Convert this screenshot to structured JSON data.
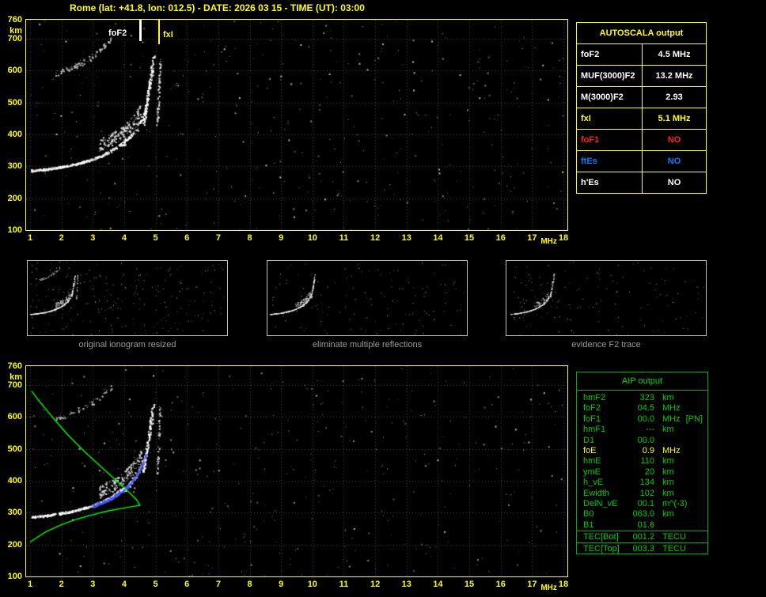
{
  "title": "Rome (lat: +41.8, lon: 012.5) - DATE: 2026 03 15 - TIME (UT): 03:00",
  "colors": {
    "background": "#000000",
    "axis_yellow": "#ffff00",
    "grid_grey": "#4a4a4a",
    "trace_white": "#ffffff",
    "profile_green": "#00ff00",
    "restored_blue": "#4455ff",
    "aip_green": "#00cc00",
    "caption_grey": "#999999",
    "alert_red": "#ff2020",
    "info_blue": "#0080ff"
  },
  "autoscala": {
    "header": "AUTOSCALA output",
    "rows": [
      {
        "label": "foF2",
        "value": "4.5 MHz",
        "color": "#ffffff"
      },
      {
        "label": "MUF(3000)F2",
        "value": "13.2 MHz",
        "color": "#ffffff"
      },
      {
        "label": "M(3000)F2",
        "value": "2.93",
        "color": "#ffffff"
      },
      {
        "label": "fxI",
        "value": "5.1 MHz",
        "color": "#ffff00"
      },
      {
        "label": "foF1",
        "value": "NO",
        "color": "#ff2020"
      },
      {
        "label": "ftEs",
        "value": "NO",
        "color": "#0080ff"
      },
      {
        "label": "h'Es",
        "value": "NO",
        "color": "#ffffff"
      }
    ]
  },
  "thumbnails": [
    {
      "caption": "original ionogram resized"
    },
    {
      "caption": "eliminate multiple reflections"
    },
    {
      "caption": "evidence F2 trace"
    }
  ],
  "aip": {
    "header": "AIP output",
    "rows": [
      {
        "label": "hmF2",
        "value": "323",
        "unit": "km",
        "note": "",
        "color": "#00cc00"
      },
      {
        "label": "foF2",
        "value": "04.5",
        "unit": "MHz",
        "note": "",
        "color": "#00cc00"
      },
      {
        "label": "foF1",
        "value": "00.0",
        "unit": "MHz",
        "note": "[PN]",
        "color": "#00cc00"
      },
      {
        "label": "hmF1",
        "value": "---",
        "unit": "km",
        "note": "",
        "color": "#00cc00"
      },
      {
        "label": "D1",
        "value": "00.0",
        "unit": "",
        "note": "",
        "color": "#00cc00"
      },
      {
        "label": "foE",
        "value": "0.9",
        "unit": "MHz",
        "note": "",
        "color": "#ffff00"
      },
      {
        "label": "hmE",
        "value": "110",
        "unit": "km",
        "note": "",
        "color": "#00cc00"
      },
      {
        "label": "ymE",
        "value": "20",
        "unit": "km",
        "note": "",
        "color": "#00cc00"
      },
      {
        "label": "h_vE",
        "value": "134",
        "unit": "km",
        "note": "",
        "color": "#00cc00"
      },
      {
        "label": "Ewidth",
        "value": "102",
        "unit": "km",
        "note": "",
        "color": "#00cc00"
      },
      {
        "label": "DelN_vE",
        "value": "00.1",
        "unit": "m^(-3)",
        "note": "",
        "color": "#00cc00"
      },
      {
        "label": "B0",
        "value": "063.0",
        "unit": "km",
        "note": "",
        "color": "#00cc00"
      },
      {
        "label": "B1",
        "value": "01.6",
        "unit": "",
        "note": "",
        "color": "#00cc00"
      }
    ],
    "tec_rows": [
      {
        "label": "TEC[Bot]",
        "value": "001.2",
        "unit": "TECU",
        "color": "#00cc00"
      },
      {
        "label": "TEC[Top]",
        "value": "003.3",
        "unit": "TECU",
        "color": "#00cc00"
      }
    ]
  },
  "chart_data": [
    {
      "type": "scatter",
      "title": "Autoscaled ionogram (virtual height vs frequency)",
      "xlabel": "MHz",
      "ylabel": "km",
      "xlim": [
        1,
        18
      ],
      "ylim": [
        100,
        760
      ],
      "x_ticks": [
        1,
        2,
        3,
        4,
        5,
        6,
        7,
        8,
        9,
        10,
        11,
        12,
        13,
        14,
        15,
        16,
        17,
        18
      ],
      "y_ticks": [
        760,
        700,
        600,
        500,
        400,
        300,
        200,
        100
      ],
      "grid": true,
      "markers": [
        {
          "name": "foF2",
          "freq_mhz": 4.5,
          "color": "#ffffff"
        },
        {
          "name": "fxI",
          "freq_mhz": 5.1,
          "color": "#ffff00"
        }
      ],
      "f2_trace": [
        [
          1.0,
          287
        ],
        [
          1.4,
          291
        ],
        [
          1.8,
          296
        ],
        [
          2.2,
          303
        ],
        [
          2.6,
          312
        ],
        [
          3.0,
          324
        ],
        [
          3.3,
          336
        ],
        [
          3.6,
          351
        ],
        [
          3.9,
          370
        ],
        [
          4.1,
          387
        ],
        [
          4.3,
          409
        ],
        [
          4.45,
          432
        ],
        [
          4.6,
          462
        ],
        [
          4.7,
          495
        ],
        [
          4.8,
          540
        ],
        [
          4.88,
          590
        ],
        [
          4.95,
          648
        ]
      ],
      "second_hop_range_mhz": [
        1.8,
        3.6
      ],
      "x_trace_freq_mhz": 5.08
    },
    {
      "type": "scatter+line",
      "title": "Ionogram with restored trace and electron density profile",
      "xlabel": "MHz",
      "ylabel": "km",
      "xlim": [
        1,
        18
      ],
      "ylim": [
        100,
        760
      ],
      "x_ticks": [
        1,
        2,
        3,
        4,
        5,
        6,
        7,
        8,
        9,
        10,
        11,
        12,
        13,
        14,
        15,
        16,
        17,
        18
      ],
      "y_ticks": [
        760,
        700,
        600,
        500,
        400,
        300,
        200,
        100
      ],
      "grid": true,
      "f2_trace": [
        [
          1.0,
          287
        ],
        [
          1.4,
          291
        ],
        [
          1.8,
          296
        ],
        [
          2.2,
          303
        ],
        [
          2.6,
          312
        ],
        [
          3.0,
          324
        ],
        [
          3.3,
          336
        ],
        [
          3.6,
          351
        ],
        [
          3.9,
          370
        ],
        [
          4.1,
          387
        ],
        [
          4.3,
          409
        ],
        [
          4.45,
          432
        ],
        [
          4.6,
          462
        ],
        [
          4.7,
          495
        ],
        [
          4.8,
          540
        ],
        [
          4.88,
          590
        ],
        [
          4.95,
          648
        ]
      ],
      "restored_trace_mhz": [
        3.0,
        4.68
      ],
      "profile_color": "#00ff00",
      "profile": [
        [
          1.0,
          208
        ],
        [
          1.5,
          240
        ],
        [
          2.0,
          262
        ],
        [
          2.5,
          280
        ],
        [
          3.0,
          294
        ],
        [
          3.5,
          306
        ],
        [
          4.0,
          315
        ],
        [
          4.3,
          320
        ],
        [
          4.5,
          323
        ],
        [
          4.4,
          340
        ],
        [
          4.15,
          365
        ],
        [
          3.7,
          405
        ],
        [
          3.2,
          450
        ],
        [
          2.7,
          495
        ],
        [
          2.2,
          545
        ],
        [
          1.8,
          590
        ],
        [
          1.5,
          625
        ],
        [
          1.25,
          655
        ],
        [
          1.05,
          682
        ]
      ]
    }
  ]
}
